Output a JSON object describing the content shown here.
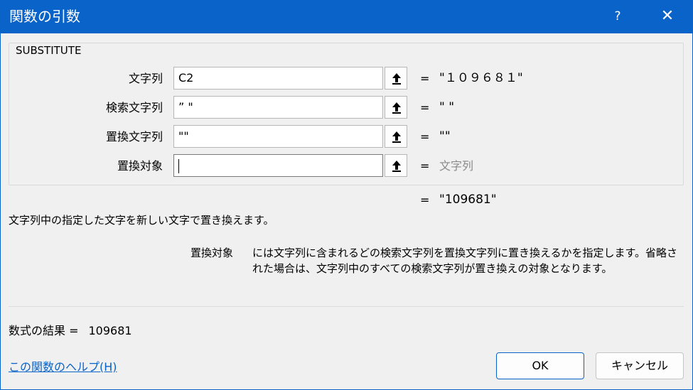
{
  "window": {
    "title": "関数の引数",
    "help_label": "?",
    "close_label": "✕",
    "accent": "#0a63c8"
  },
  "function_name": "SUBSTITUTE",
  "arguments": [
    {
      "label": "文字列",
      "value": "C2",
      "eval": "\"１０９６８１\""
    },
    {
      "label": "検索文字列",
      "value": "” \"",
      "eval": "\" \""
    },
    {
      "label": "置換文字列",
      "value": "\"\"",
      "eval": "\"\""
    },
    {
      "label": "置換対象",
      "value": "",
      "eval": "文字列"
    }
  ],
  "equals": "=",
  "overall_eval": "\"109681\"",
  "description": "文字列中の指定した文字を新しい文字で置き換えます。",
  "detail": {
    "arg_name": "置換対象",
    "text": "には文字列に含まれるどの検索文字列を置換文字列に置き換えるかを指定します。省略された場合は、文字列中のすべての検索文字列が置き換えの対象となります。"
  },
  "result": {
    "label": "数式の結果 =",
    "value": "109681"
  },
  "help_link": "この関数のヘルプ(H)",
  "buttons": {
    "ok": "OK",
    "cancel": "キャンセル"
  }
}
